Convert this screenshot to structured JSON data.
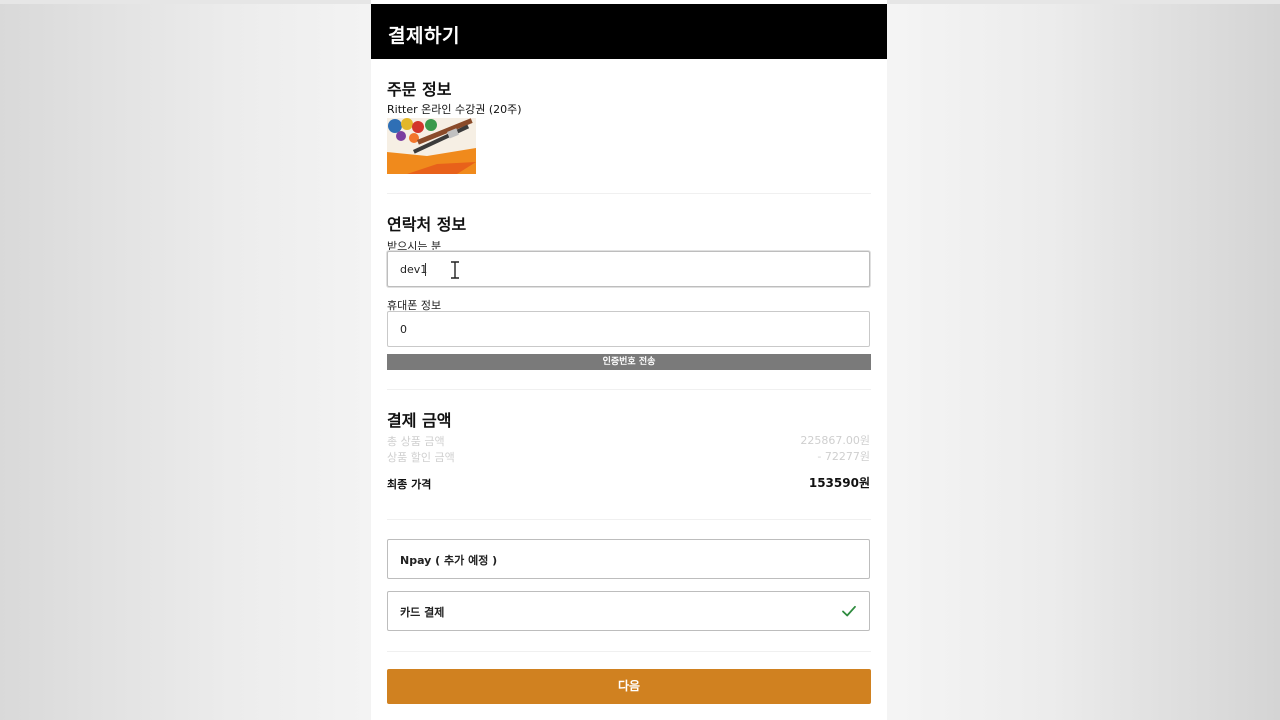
{
  "header": {
    "title": "결제하기"
  },
  "order": {
    "section_title": "주문 정보",
    "product_name": "Ritter 온라인 수강권 (20주)"
  },
  "contact": {
    "section_title": "연락처 정보",
    "recipient_label": "받으시는 분",
    "recipient_value": "dev1",
    "phone_label": "휴대폰 정보",
    "phone_value": "0",
    "send_code_label": "인증번호 전송"
  },
  "payment": {
    "section_title": "결제 금액",
    "total_product_label": "총 상품 금액",
    "total_product_value": "225867.00원",
    "discount_label": "상품 할인 금액",
    "discount_value": "- 72277원",
    "final_label": "최종 가격",
    "final_value": "153590원"
  },
  "methods": [
    {
      "label": "Npay ( 추가 예정 )",
      "selected": false
    },
    {
      "label": "카드 결제",
      "selected": true
    }
  ],
  "next_label": "다음",
  "colors": {
    "header_bg": "#000000",
    "accent": "#d08120",
    "send_button": "#7a7a7a",
    "check": "#2e8b3e"
  }
}
